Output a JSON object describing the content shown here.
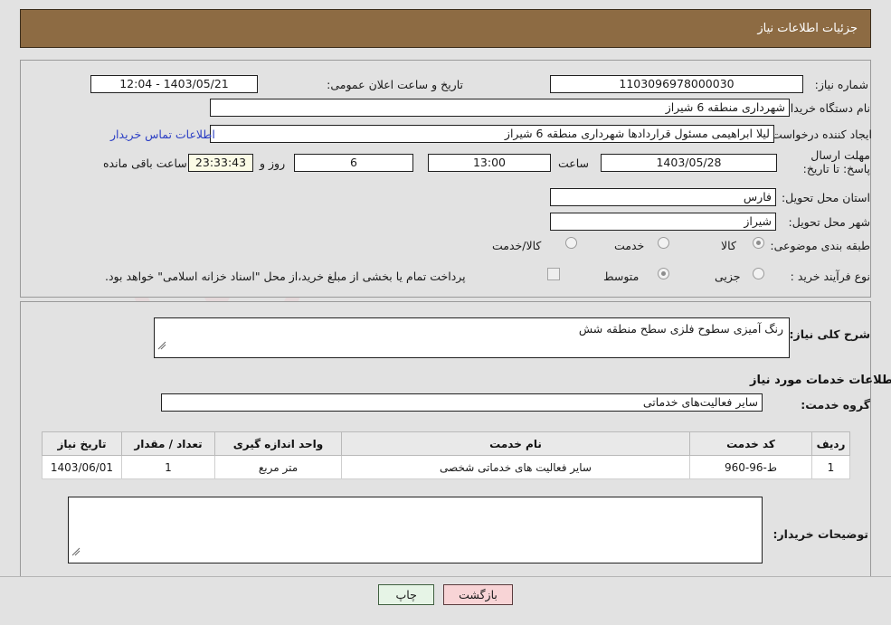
{
  "header": {
    "title": "جزئیات اطلاعات نیاز"
  },
  "form": {
    "need_number_label": "شماره نیاز:",
    "need_number_value": "1103096978000030",
    "announce_label": "تاریخ و ساعت اعلان عمومی:",
    "announce_value": "1403/05/21 - 12:04",
    "buyer_org_label": "نام دستگاه خریدار:",
    "buyer_org_value": "شهرداری منطقه 6 شیراز",
    "creator_label": "ایجاد کننده درخواست:",
    "creator_value": "لیلا ابراهیمی مسئول قراردادها شهرداری منطقه 6 شیراز",
    "contact_link": "اطلاعات تماس خریدار",
    "deadline_label": "مهلت ارسال پاسخ: تا تاریخ:",
    "deadline_date": "1403/05/28",
    "deadline_hour_label": "ساعت",
    "deadline_hour": "13:00",
    "remaining_days": "6",
    "remaining_days_label": "روز و",
    "remaining_timer": "23:33:43",
    "remaining_suffix": "ساعت باقی مانده",
    "province_label": "استان محل تحویل:",
    "province_value": "فارس",
    "city_label": "شهر محل تحویل:",
    "city_value": "شیراز",
    "category_label": "طبقه بندی موضوعی:",
    "category_options": [
      {
        "label": "کالا",
        "selected": false
      },
      {
        "label": "خدمت",
        "selected": true
      },
      {
        "label": "کالا/خدمت",
        "selected": false
      }
    ],
    "process_label": "نوع فرآیند خرید :",
    "process_options": [
      {
        "label": "جزیی",
        "selected": false
      },
      {
        "label": "متوسط",
        "selected": true
      }
    ],
    "treasury_checkbox_label": "پرداخت تمام یا بخشی از مبلغ خرید،از محل \"اسناد خزانه اسلامی\" خواهد بود.",
    "treasury_checked": false
  },
  "description": {
    "label": "شرح کلی نیاز:",
    "value": "رنگ آمیزی سطوح فلزی سطح منطقه شش"
  },
  "services_section": {
    "heading": "اطلاعات خدمات مورد نیاز",
    "group_label": "گروه خدمت:",
    "group_value": "سایر فعالیت‌های خدماتی"
  },
  "table": {
    "columns": [
      "ردیف",
      "کد خدمت",
      "نام خدمت",
      "واحد اندازه گیری",
      "تعداد / مقدار",
      "تاریخ نیاز"
    ],
    "rows": [
      [
        "1",
        "ط-96-960",
        "سایر فعالیت های خدماتی شخصی",
        "متر مربع",
        "1",
        "1403/06/01"
      ]
    ]
  },
  "buyer_notes": {
    "label": "توضیحات خریدار:",
    "value": ""
  },
  "buttons": {
    "back": "بازگشت",
    "print": "چاپ"
  },
  "watermark": {
    "text": "AriaTender.net"
  },
  "colors": {
    "header_bar": "#8d6b43",
    "page_bg": "#e2e2e2",
    "link": "#2b3ec4",
    "timer_bg": "#fbfbe6",
    "btn_back_bg": "#f8d4d6",
    "btn_print_bg": "#e6f4e6"
  }
}
